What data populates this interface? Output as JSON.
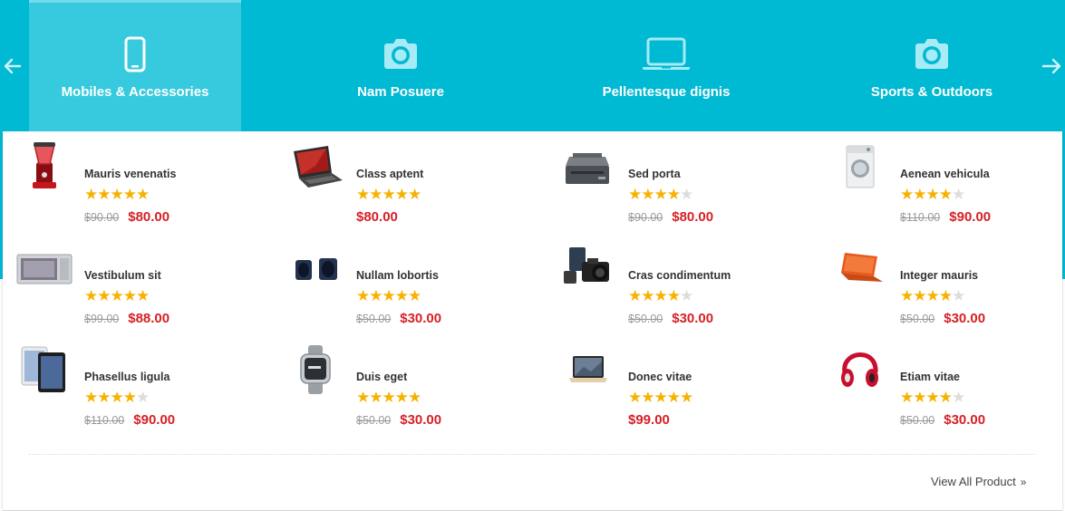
{
  "colors": {
    "band": "#00b9d3",
    "active_tab": "#37cade",
    "price": "#d62027",
    "star": "#f5b301"
  },
  "nav": {
    "prev_icon": "arrow-left-icon",
    "next_icon": "arrow-right-icon"
  },
  "categories": [
    {
      "label": "Mobiles & Accessories",
      "icon": "smartphone-icon",
      "active": true
    },
    {
      "label": "Nam Posuere",
      "icon": "camera-icon",
      "active": false
    },
    {
      "label": "Pellentesque dignis",
      "icon": "laptop-icon",
      "active": false
    },
    {
      "label": "Sports & Outdoors",
      "icon": "camera-icon",
      "active": false
    }
  ],
  "products": [
    {
      "name": "Mauris venenatis",
      "rating": 5,
      "old_price": "$90.00",
      "price": "$80.00",
      "image": "blender"
    },
    {
      "name": "Class aptent",
      "rating": 5,
      "old_price": "",
      "price": "$80.00",
      "image": "laptop"
    },
    {
      "name": "Sed porta",
      "rating": 4,
      "old_price": "$90.00",
      "price": "$80.00",
      "image": "printer"
    },
    {
      "name": "Aenean vehicula",
      "rating": 4,
      "old_price": "$110.00",
      "price": "$90.00",
      "image": "washer"
    },
    {
      "name": "Vestibulum sit",
      "rating": 5,
      "old_price": "$99.00",
      "price": "$88.00",
      "image": "microwave"
    },
    {
      "name": "Nullam lobortis",
      "rating": 5,
      "old_price": "$50.00",
      "price": "$30.00",
      "image": "speakers"
    },
    {
      "name": "Cras condimentum",
      "rating": 4,
      "old_price": "$50.00",
      "price": "$30.00",
      "image": "camera"
    },
    {
      "name": "Integer mauris",
      "rating": 4,
      "old_price": "$50.00",
      "price": "$30.00",
      "image": "orange-laptop"
    },
    {
      "name": "Phasellus ligula",
      "rating": 4,
      "old_price": "$110.00",
      "price": "$90.00",
      "image": "tablets"
    },
    {
      "name": "Duis eget",
      "rating": 5,
      "old_price": "$50.00",
      "price": "$30.00",
      "image": "smartwatch"
    },
    {
      "name": "Donec vitae",
      "rating": 5,
      "old_price": "",
      "price": "$99.00",
      "image": "macbook"
    },
    {
      "name": "Etiam vitae",
      "rating": 4,
      "old_price": "$50.00",
      "price": "$30.00",
      "image": "headphones"
    }
  ],
  "footer": {
    "view_all": "View All Product",
    "chevron_icon": "double-chevron-right-icon"
  }
}
